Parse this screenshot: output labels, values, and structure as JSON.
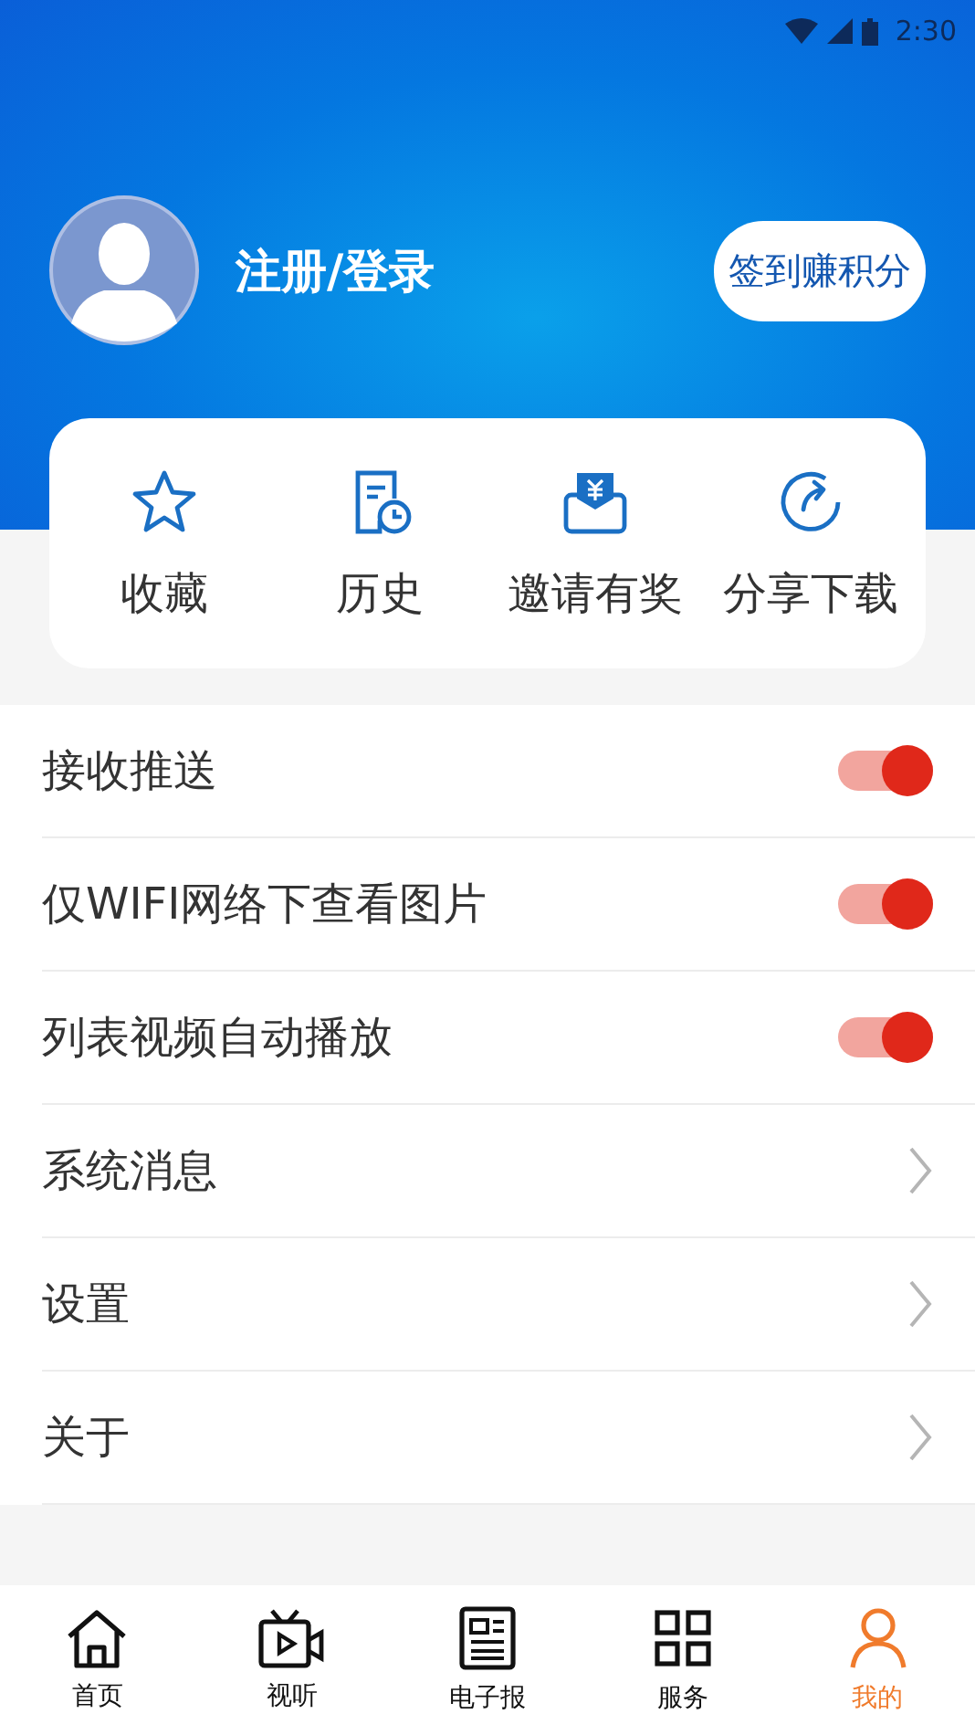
{
  "status_bar": {
    "time": "2:30"
  },
  "profile": {
    "login_label": "注册/登录",
    "checkin_button": "签到赚积分"
  },
  "shortcuts": [
    {
      "kind": "star",
      "label": "收藏"
    },
    {
      "kind": "history",
      "label": "历史"
    },
    {
      "kind": "invite",
      "label": "邀请有奖"
    },
    {
      "kind": "share",
      "label": "分享下载"
    }
  ],
  "settings": [
    {
      "kind": "toggle",
      "label": "接收推送",
      "on": true
    },
    {
      "kind": "toggle",
      "label": "仅WIFI网络下查看图片",
      "on": true
    },
    {
      "kind": "toggle",
      "label": "列表视频自动播放",
      "on": true
    },
    {
      "kind": "link",
      "label": "系统消息"
    },
    {
      "kind": "link",
      "label": "设置"
    },
    {
      "kind": "link",
      "label": "关于"
    }
  ],
  "tab_bar": [
    {
      "kind": "home",
      "label": "首页",
      "selected": false
    },
    {
      "kind": "video",
      "label": "视听",
      "selected": false
    },
    {
      "kind": "news",
      "label": "电子报",
      "selected": false
    },
    {
      "kind": "service",
      "label": "服务",
      "selected": false
    },
    {
      "kind": "me",
      "label": "我的",
      "selected": true
    }
  ]
}
